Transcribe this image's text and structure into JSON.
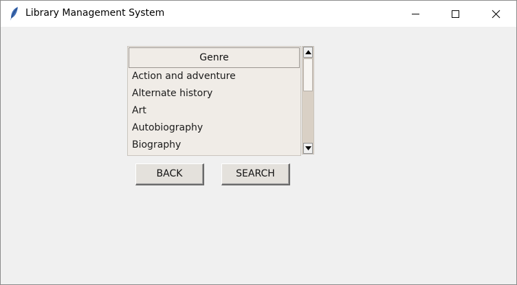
{
  "window": {
    "title": "Library Management System",
    "icon": "feather-icon",
    "controls": [
      "minimize-icon",
      "maximize-icon",
      "close-icon"
    ]
  },
  "genre_list": {
    "header": "Genre",
    "items": [
      "Action and adventure",
      "Alternate history",
      "Art",
      "Autobiography",
      "Biography"
    ]
  },
  "buttons": {
    "back_label": "BACK",
    "search_label": "SEARCH"
  },
  "colors": {
    "window_bg": "#f0f0f0",
    "titlebar_bg": "#ffffff",
    "list_bg": "#f0ece7",
    "scroll_trough": "#d9d0c5"
  }
}
